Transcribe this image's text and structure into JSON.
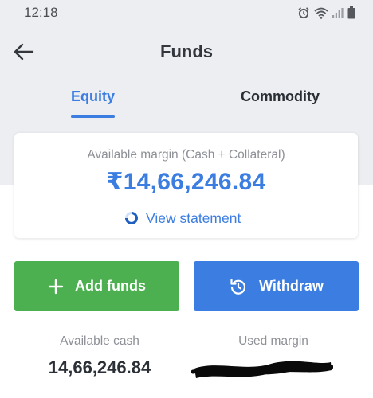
{
  "status_bar": {
    "time": "12:18",
    "icons": [
      "alarm-icon",
      "wifi-icon",
      "signal-icon",
      "battery-icon"
    ]
  },
  "header": {
    "title": "Funds",
    "back_icon": "arrow-left-icon"
  },
  "tabs": [
    {
      "label": "Equity",
      "active": true
    },
    {
      "label": "Commodity",
      "active": false
    }
  ],
  "margin_card": {
    "label": "Available margin (Cash + Collateral)",
    "value": "₹14,66,246.84",
    "link_label": "View statement",
    "link_icon": "statement-spinner-icon"
  },
  "actions": {
    "add_funds": {
      "label": "Add funds",
      "icon": "plus-icon"
    },
    "withdraw": {
      "label": "Withdraw",
      "icon": "refresh-icon"
    }
  },
  "summary": {
    "cash_label": "Available cash",
    "cash_value": "14,66,246.84",
    "used_label": "Used margin"
  },
  "colors": {
    "accent": "#3b7de0",
    "add_button": "#4caf50",
    "header_bg": "#eceef1"
  }
}
